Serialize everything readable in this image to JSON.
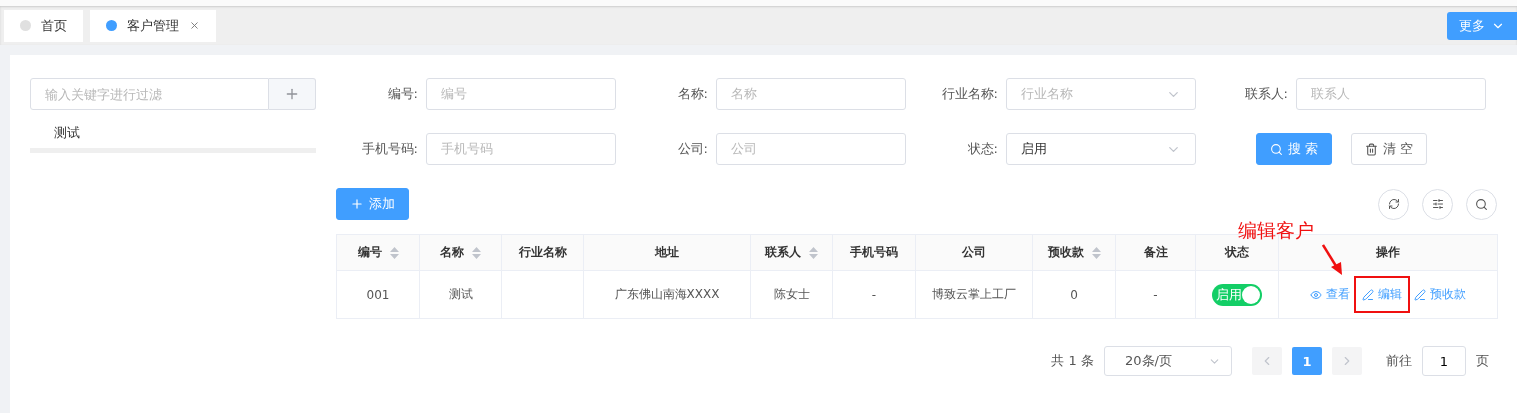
{
  "tabs": [
    {
      "label": "首页",
      "selected": false,
      "closable": false
    },
    {
      "label": "客户管理",
      "selected": true,
      "closable": true
    }
  ],
  "more_button": "更多",
  "tree": {
    "filter_placeholder": "输入关键字进行过滤",
    "items": [
      {
        "label": "测试",
        "selected": true
      }
    ]
  },
  "form": {
    "fields": [
      {
        "label": "编号:",
        "placeholder": "编号",
        "kind": "input"
      },
      {
        "label": "名称:",
        "placeholder": "名称",
        "kind": "input"
      },
      {
        "label": "行业名称:",
        "placeholder": "行业名称",
        "kind": "select"
      },
      {
        "label": "联系人:",
        "placeholder": "联系人",
        "kind": "input"
      },
      {
        "label": "手机号码:",
        "placeholder": "手机号码",
        "kind": "input"
      },
      {
        "label": "公司:",
        "placeholder": "公司",
        "kind": "input"
      },
      {
        "label": "状态:",
        "value": "启用",
        "kind": "select"
      }
    ],
    "search_button": "搜 索",
    "clear_button": "清 空"
  },
  "add_button": "添加",
  "table": {
    "columns": [
      {
        "label": "编号",
        "sortable": true
      },
      {
        "label": "名称",
        "sortable": true
      },
      {
        "label": "行业名称",
        "sortable": false
      },
      {
        "label": "地址",
        "sortable": false
      },
      {
        "label": "联系人",
        "sortable": true
      },
      {
        "label": "手机号码",
        "sortable": false
      },
      {
        "label": "公司",
        "sortable": false
      },
      {
        "label": "预收款",
        "sortable": true
      },
      {
        "label": "备注",
        "sortable": false
      },
      {
        "label": "状态",
        "sortable": false
      },
      {
        "label": "操作",
        "sortable": false
      }
    ],
    "rows": [
      {
        "cells": [
          "001",
          "测试",
          "",
          "广东佛山南海XXXX",
          "陈女士",
          "-",
          "博致云掌上工厂",
          "0",
          "-"
        ],
        "status": {
          "label": "启用",
          "on": true
        },
        "actions": [
          {
            "label": "查看",
            "kind": "view",
            "highlighted": false
          },
          {
            "label": "编辑",
            "kind": "edit",
            "highlighted": true
          },
          {
            "label": "预收款",
            "kind": "edit",
            "highlighted": false
          }
        ]
      }
    ]
  },
  "annotation": {
    "text": "编辑客户"
  },
  "pagination": {
    "total": "共 1 条",
    "page_size": "20条/页",
    "pages": [
      {
        "label": "1",
        "selected": true
      }
    ],
    "goto_label": "前往",
    "goto_value": "1",
    "page_suffix": "页"
  }
}
